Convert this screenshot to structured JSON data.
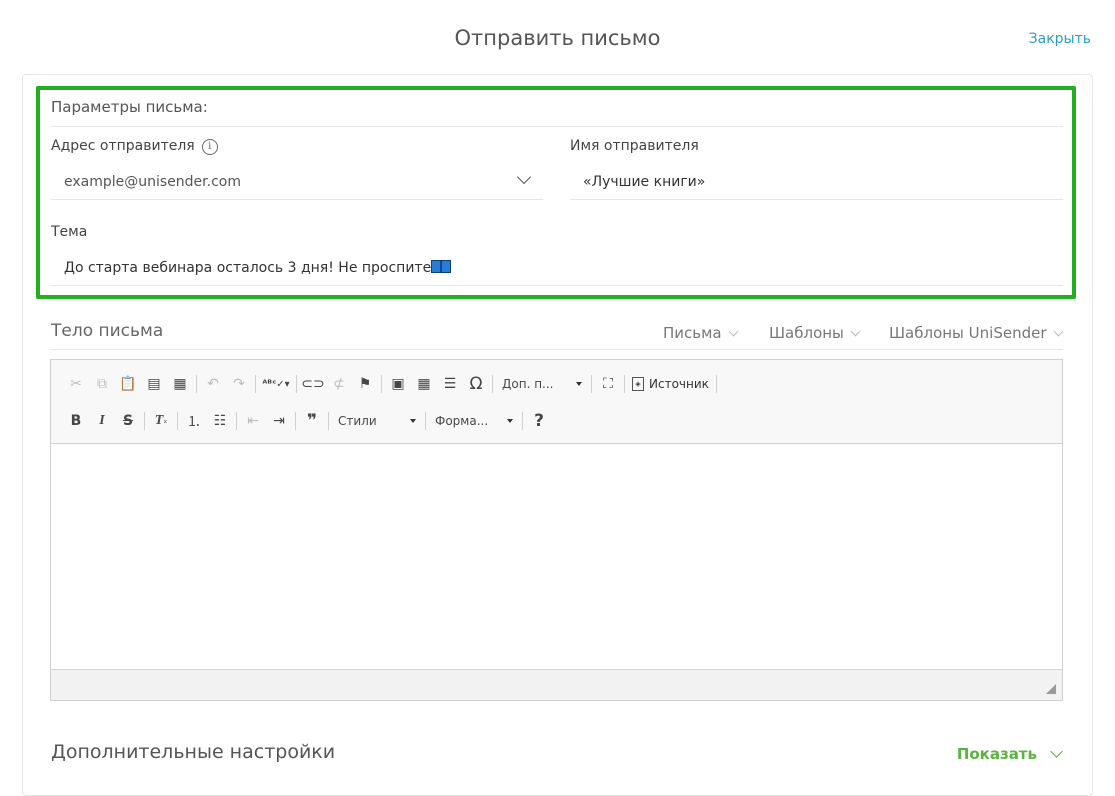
{
  "header": {
    "title": "Отправить письмо",
    "close_label": "Закрыть"
  },
  "params": {
    "section_title": "Параметры письма:",
    "sender_address": {
      "label": "Адрес отправителя",
      "value": "example@unisender.com"
    },
    "sender_name": {
      "label": "Имя отправителя",
      "value": "«Лучшие книги»"
    },
    "subject": {
      "label": "Тема",
      "value": "До старта вебинара осталось 3 дня! Не проспите"
    }
  },
  "body": {
    "title": "Тело письма",
    "links": [
      "Письма",
      "Шаблоны",
      "Шаблоны UniSender"
    ]
  },
  "editor": {
    "row1": {
      "extra_plugins": "Доп. п...",
      "source_label": "Источник"
    },
    "row2": {
      "styles_label": "Стили",
      "format_label": "Форма..."
    }
  },
  "extra": {
    "title": "Дополнительные настройки",
    "show_label": "Показать"
  },
  "colors": {
    "accent": "#2d9fbd",
    "highlight_border": "#22b022",
    "show_link": "#5ab340"
  }
}
